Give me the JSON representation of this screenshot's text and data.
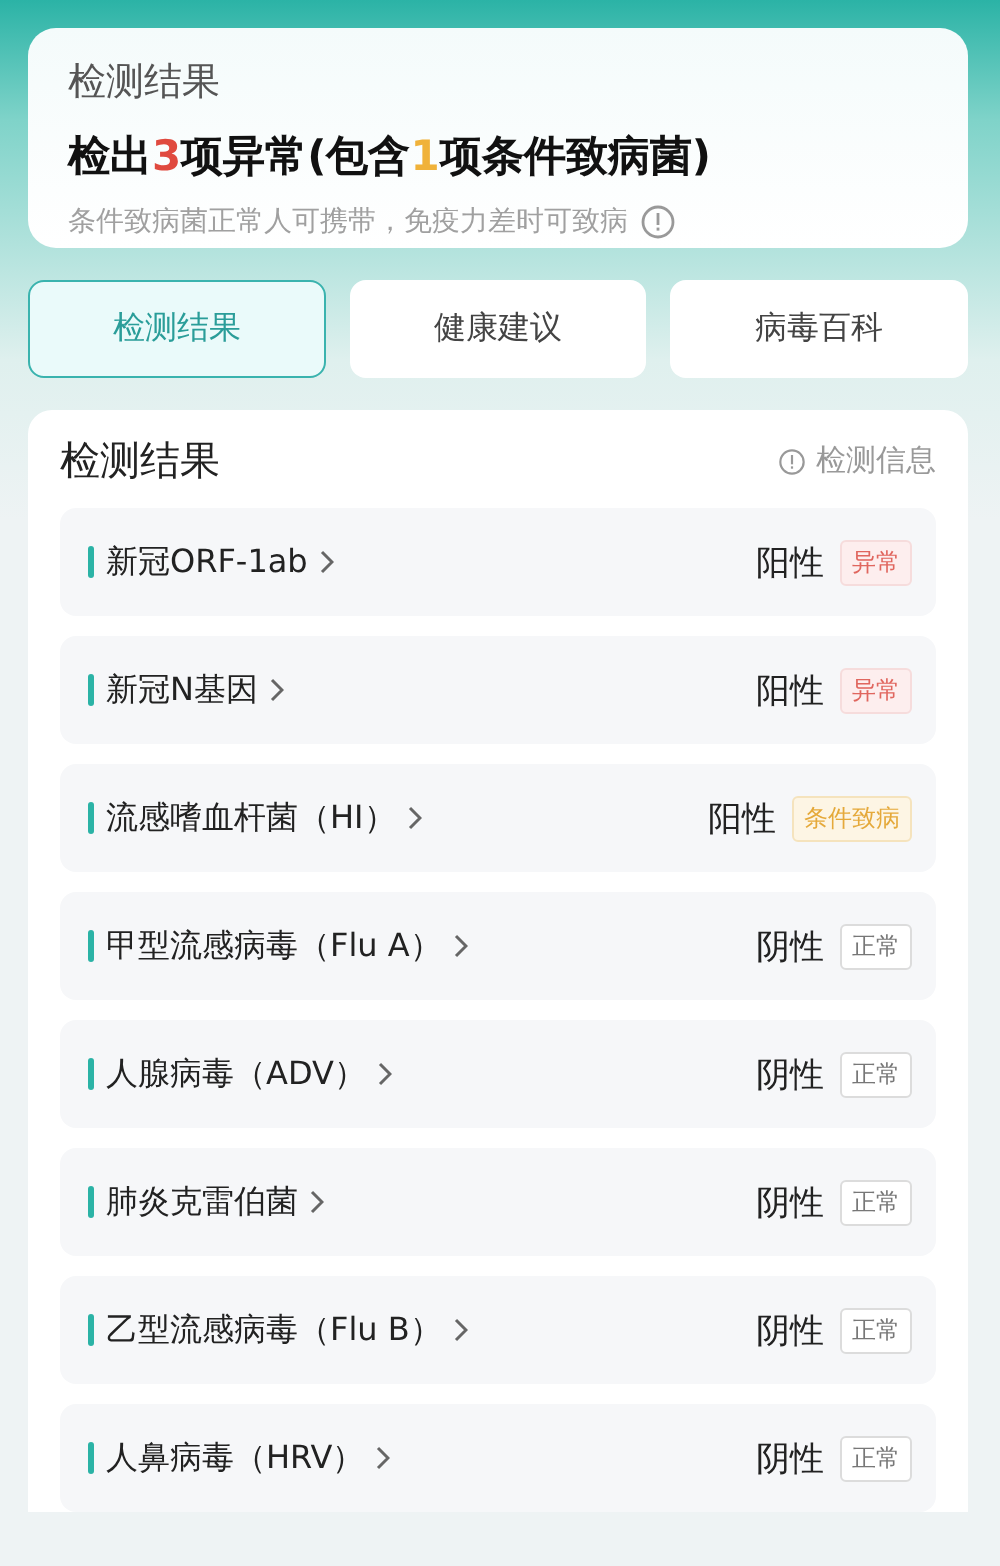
{
  "summary": {
    "title": "检测结果",
    "headline": [
      {
        "text": "检出",
        "kind": "plain"
      },
      {
        "text": "3",
        "kind": "abnormal"
      },
      {
        "text": "项异常(包含",
        "kind": "plain"
      },
      {
        "text": "1",
        "kind": "conditional"
      },
      {
        "text": "项条件致病菌)",
        "kind": "plain"
      }
    ],
    "note": "条件致病菌正常人可携带，免疫力差时可致病"
  },
  "tabs": [
    {
      "label": "检测结果",
      "selected": true
    },
    {
      "label": "健康建议",
      "selected": false
    },
    {
      "label": "病毒百科",
      "selected": false
    }
  ],
  "results": {
    "title": "检测结果",
    "info_link": "检测信息",
    "rows": [
      {
        "name": "新冠ORF-1ab",
        "status": "阳性",
        "badge": "异常",
        "kind": "abnormal"
      },
      {
        "name": "新冠N基因",
        "status": "阳性",
        "badge": "异常",
        "kind": "abnormal"
      },
      {
        "name": "流感嗜血杆菌（HI）",
        "status": "阳性",
        "badge": "条件致病",
        "kind": "conditional"
      },
      {
        "name": "甲型流感病毒（Flu A）",
        "status": "阴性",
        "badge": "正常",
        "kind": "normal"
      },
      {
        "name": "人腺病毒（ADV）",
        "status": "阴性",
        "badge": "正常",
        "kind": "normal"
      },
      {
        "name": "肺炎克雷伯菌",
        "status": "阴性",
        "badge": "正常",
        "kind": "normal"
      },
      {
        "name": "乙型流感病毒（Flu B）",
        "status": "阴性",
        "badge": "正常",
        "kind": "normal"
      },
      {
        "name": "人鼻病毒（HRV）",
        "status": "阴性",
        "badge": "正常",
        "kind": "normal"
      }
    ]
  }
}
